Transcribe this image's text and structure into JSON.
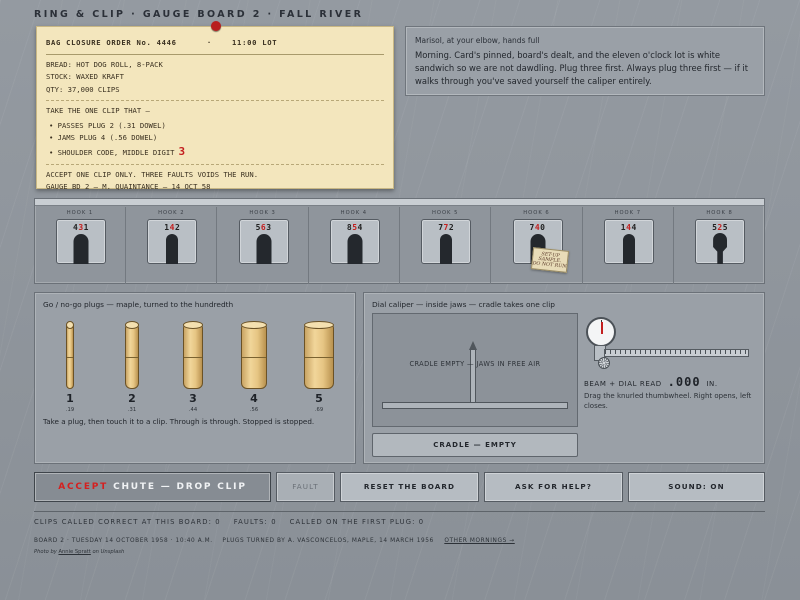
{
  "app_title": "RING & CLIP · GAUGE BOARD 2 · FALL RIVER",
  "order_card": {
    "order_no": "BAG CLOSURE ORDER No. 4446",
    "sep": "·",
    "lot": "11:00 LOT",
    "bread": "BREAD: HOT DOG ROLL, 8-PACK",
    "stock": "STOCK: WAXED KRAFT",
    "qty": "QTY: 37,000 CLIPS",
    "take": "TAKE THE ONE CLIP THAT —",
    "rules": [
      {
        "text": "PASSES PLUG 2  (.31 DOWEL)"
      },
      {
        "text": "JAMS PLUG 4  (.56 DOWEL)"
      },
      {
        "text": "SHOULDER CODE, MIDDLE DIGIT",
        "digit": "3"
      }
    ],
    "accept_note": "ACCEPT ONE CLIP ONLY. THREE FAULTS VOIDS THE RUN.",
    "signoff": "GAUGE BD 2 — M. QUAINTANCE — 14 OCT 58"
  },
  "chat": {
    "who": "Marisol, at your elbow, hands full",
    "message": "Morning. Card's pinned, board's dealt, and the eleven o'clock lot is white sandwich so we are not dawdling. Plug three first. Always plug three first — if it walks through you've saved yourself the caliper entirely."
  },
  "board": {
    "hooks": [
      {
        "label": "HOOK 1",
        "d1": "4",
        "d2": "3",
        "d3": "1",
        "shape": "round"
      },
      {
        "label": "HOOK 2",
        "d1": "1",
        "d2": "4",
        "d3": "2",
        "shape": "narrow"
      },
      {
        "label": "HOOK 3",
        "d1": "5",
        "d2": "6",
        "d3": "3",
        "shape": "round"
      },
      {
        "label": "HOOK 4",
        "d1": "8",
        "d2": "5",
        "d3": "4",
        "shape": "round"
      },
      {
        "label": "HOOK 5",
        "d1": "7",
        "d2": "7",
        "d3": "2",
        "shape": "narrow"
      },
      {
        "label": "HOOK 6",
        "d1": "7",
        "d2": "4",
        "d3": "0",
        "shape": "round"
      },
      {
        "label": "HOOK 7",
        "d1": "1",
        "d2": "4",
        "d3": "4",
        "shape": "narrow"
      },
      {
        "label": "HOOK 8",
        "d1": "5",
        "d2": "2",
        "d3": "5",
        "shape": "key"
      }
    ],
    "setup_tag": {
      "line1": "SET-UP",
      "line2": "SAMPLE.",
      "line3": "DO NOT RUN"
    }
  },
  "plugs": {
    "title": "Go / no-go plugs — maple, turned to the hundredth",
    "items": [
      {
        "num": "1",
        "size": ".19"
      },
      {
        "num": "2",
        "size": ".31"
      },
      {
        "num": "3",
        "size": ".44"
      },
      {
        "num": "4",
        "size": ".56"
      },
      {
        "num": "5",
        "size": ".69"
      }
    ],
    "hint": "Take a plug, then touch it to a clip. Through is through. Stopped is stopped."
  },
  "caliper": {
    "title": "Dial caliper — inside jaws — cradle takes one clip",
    "cradle_label": "CRADLE EMPTY — JAWS IN FREE AIR",
    "cradle_status": "CRADLE — EMPTY",
    "readout_label": "BEAM + DIAL READ",
    "readout_value": ".000",
    "readout_unit": "IN.",
    "hint": "Drag the knurled thumbwheel. Right opens, left closes."
  },
  "actions": {
    "accept_word": "ACCEPT",
    "accept_rest": "CHUTE — DROP CLIP",
    "fault": "FAULT",
    "reset": "RESET THE BOARD",
    "help": "ASK FOR HELP?",
    "sound": "SOUND: ON"
  },
  "score_line": "CLIPS CALLED CORRECT AT THIS BOARD: 0    FAULTS: 0    CALLED ON THE FIRST PLUG: 0",
  "footer": {
    "text": "BOARD 2 · TUESDAY 14 OCTOBER 1958 · 10:40 A.M.    PLUGS TURNED BY A. VASCONCELOS, MAPLE, 14 MARCH 1956",
    "link": "OTHER MORNINGS →"
  },
  "credit": {
    "prefix": "Photo by ",
    "author": "Annie Spratt",
    "suffix": " on Unsplash"
  },
  "colors": {
    "accent_red": "#c32020",
    "card": "#f3e6bd",
    "panel": "#9aa0a7"
  }
}
